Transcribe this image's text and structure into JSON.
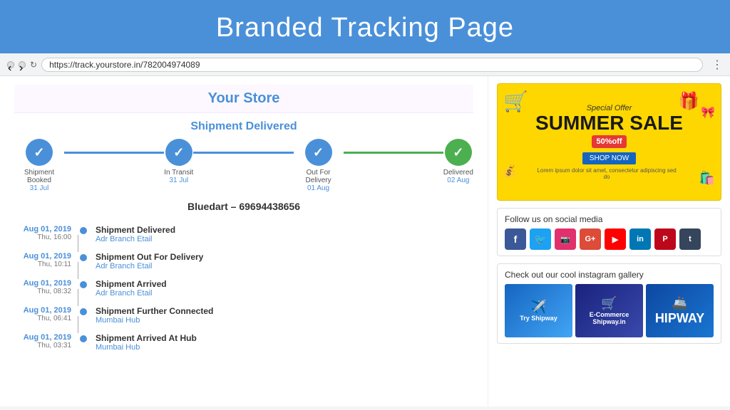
{
  "header": {
    "title": "Branded Tracking Page"
  },
  "browser": {
    "url": "https://track.yourstore.in/782004974089",
    "menu_icon": "⋮"
  },
  "store": {
    "name": "Your Store"
  },
  "tracking": {
    "status_title": "Shipment Delivered",
    "courier": "Bluedart – 69694438656",
    "steps": [
      {
        "label": "Shipment Booked",
        "date": "31 Jul",
        "type": "blue",
        "check": "✓"
      },
      {
        "label": "In Transit",
        "date": "31 Jul",
        "type": "blue",
        "check": "✓"
      },
      {
        "label": "Out For Delivery",
        "date": "01 Aug",
        "type": "blue",
        "check": "✓"
      },
      {
        "label": "Delivered",
        "date": "02 Aug",
        "type": "green",
        "check": "✓"
      }
    ],
    "timeline": [
      {
        "date": "Aug 01, 2019",
        "day": "Thu, 16:00",
        "event": "Shipment Delivered",
        "location": "Adr Branch Etail"
      },
      {
        "date": "Aug 01, 2019",
        "day": "Thu, 10:11",
        "event": "Shipment Out For Delivery",
        "location": "Adr Branch Etail"
      },
      {
        "date": "Aug 01, 2019",
        "day": "Thu, 08:32",
        "event": "Shipment Arrived",
        "location": "Adr Branch Etail"
      },
      {
        "date": "Aug 01, 2019",
        "day": "Thu, 06:41",
        "event": "Shipment Further Connected",
        "location": "Mumbai Hub"
      },
      {
        "date": "Aug 01, 2019",
        "day": "Thu, 03:31",
        "event": "Shipment Arrived At Hub",
        "location": "Mumbai Hub"
      }
    ]
  },
  "ad": {
    "special_offer": "Special Offer",
    "title": "SUMMER SALE",
    "discount": "50%off",
    "shop_now": "SHOP NOW",
    "description": "Lorem ipsum dolor sit amet, consectetur adipiscing sed do"
  },
  "social": {
    "title": "Follow us on social media",
    "platforms": [
      "f",
      "t",
      "in",
      "G+",
      "▶",
      "in",
      "P",
      "t"
    ]
  },
  "instagram": {
    "title": "Check out our cool instagram gallery",
    "images": [
      "Try Shipway",
      "E-Commerce",
      "HIPWAY"
    ]
  }
}
